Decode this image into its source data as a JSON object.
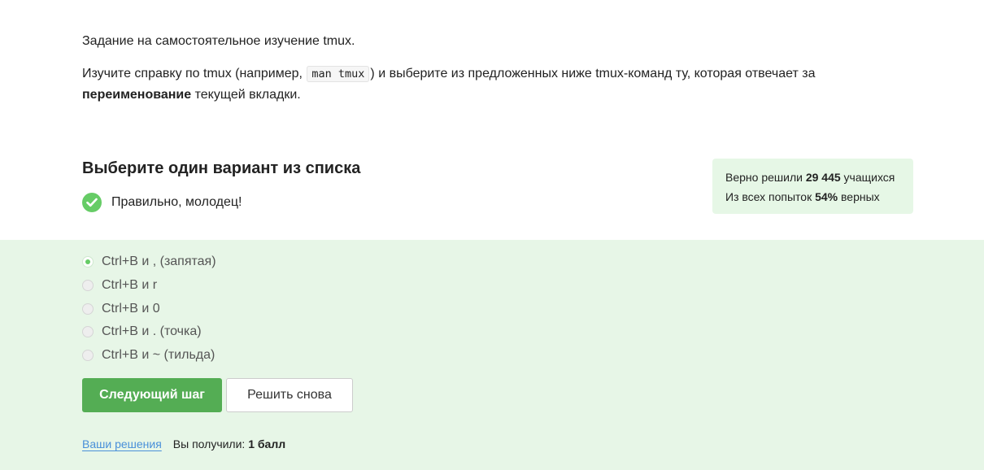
{
  "task": {
    "intro": "Задание на самостоятельное изучение tmux.",
    "line_before_code": "Изучите справку по tmux (например, ",
    "code": "man tmux",
    "line_after_code": ") и выберите из предложенных ниже tmux-команд ту, которая отвечает за",
    "bold_word": "переименование",
    "line_end": " текущей вкладки."
  },
  "question": {
    "title": "Выберите один вариант из списка",
    "feedback": "Правильно, молодец!"
  },
  "stats": {
    "solved_prefix": "Верно решили ",
    "solved_count": "29 445",
    "solved_suffix": " учащихся",
    "attempts_prefix": "Из всех попыток ",
    "attempts_percent": "54%",
    "attempts_suffix": " верных"
  },
  "options": [
    {
      "label": "Ctrl+B и , (запятая)",
      "selected": true
    },
    {
      "label": "Ctrl+B и r",
      "selected": false
    },
    {
      "label": "Ctrl+B и 0",
      "selected": false
    },
    {
      "label": "Ctrl+B и . (точка)",
      "selected": false
    },
    {
      "label": "Ctrl+B и ~ (тильда)",
      "selected": false
    }
  ],
  "buttons": {
    "next": "Следующий шаг",
    "retry": "Решить снова"
  },
  "footer": {
    "solutions_link": "Ваши решения",
    "received_label": "Вы получили: ",
    "received_value": "1 балл"
  },
  "colors": {
    "accent_green": "#54ad54",
    "check_green": "#66cc66",
    "panel_bg": "#e7f6e7",
    "stats_bg": "#e6f7e6",
    "link_blue": "#4a90d9"
  }
}
